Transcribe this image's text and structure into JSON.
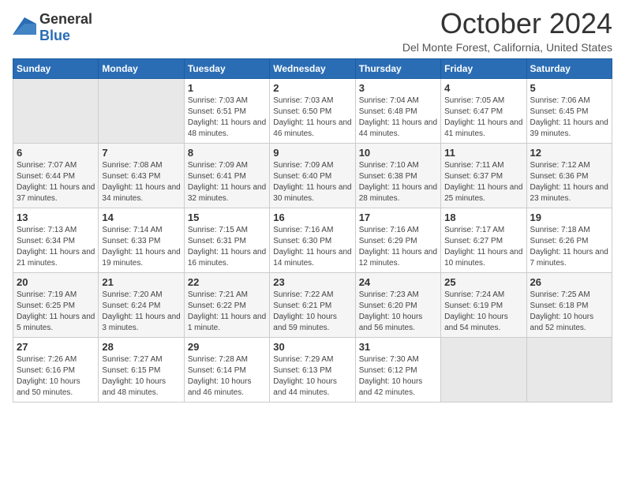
{
  "header": {
    "logo_general": "General",
    "logo_blue": "Blue",
    "month_title": "October 2024",
    "location": "Del Monte Forest, California, United States"
  },
  "calendar": {
    "days_of_week": [
      "Sunday",
      "Monday",
      "Tuesday",
      "Wednesday",
      "Thursday",
      "Friday",
      "Saturday"
    ],
    "weeks": [
      [
        {
          "day": "",
          "sunrise": "",
          "sunset": "",
          "daylight": ""
        },
        {
          "day": "",
          "sunrise": "",
          "sunset": "",
          "daylight": ""
        },
        {
          "day": "1",
          "sunrise": "Sunrise: 7:03 AM",
          "sunset": "Sunset: 6:51 PM",
          "daylight": "Daylight: 11 hours and 48 minutes."
        },
        {
          "day": "2",
          "sunrise": "Sunrise: 7:03 AM",
          "sunset": "Sunset: 6:50 PM",
          "daylight": "Daylight: 11 hours and 46 minutes."
        },
        {
          "day": "3",
          "sunrise": "Sunrise: 7:04 AM",
          "sunset": "Sunset: 6:48 PM",
          "daylight": "Daylight: 11 hours and 44 minutes."
        },
        {
          "day": "4",
          "sunrise": "Sunrise: 7:05 AM",
          "sunset": "Sunset: 6:47 PM",
          "daylight": "Daylight: 11 hours and 41 minutes."
        },
        {
          "day": "5",
          "sunrise": "Sunrise: 7:06 AM",
          "sunset": "Sunset: 6:45 PM",
          "daylight": "Daylight: 11 hours and 39 minutes."
        }
      ],
      [
        {
          "day": "6",
          "sunrise": "Sunrise: 7:07 AM",
          "sunset": "Sunset: 6:44 PM",
          "daylight": "Daylight: 11 hours and 37 minutes."
        },
        {
          "day": "7",
          "sunrise": "Sunrise: 7:08 AM",
          "sunset": "Sunset: 6:43 PM",
          "daylight": "Daylight: 11 hours and 34 minutes."
        },
        {
          "day": "8",
          "sunrise": "Sunrise: 7:09 AM",
          "sunset": "Sunset: 6:41 PM",
          "daylight": "Daylight: 11 hours and 32 minutes."
        },
        {
          "day": "9",
          "sunrise": "Sunrise: 7:09 AM",
          "sunset": "Sunset: 6:40 PM",
          "daylight": "Daylight: 11 hours and 30 minutes."
        },
        {
          "day": "10",
          "sunrise": "Sunrise: 7:10 AM",
          "sunset": "Sunset: 6:38 PM",
          "daylight": "Daylight: 11 hours and 28 minutes."
        },
        {
          "day": "11",
          "sunrise": "Sunrise: 7:11 AM",
          "sunset": "Sunset: 6:37 PM",
          "daylight": "Daylight: 11 hours and 25 minutes."
        },
        {
          "day": "12",
          "sunrise": "Sunrise: 7:12 AM",
          "sunset": "Sunset: 6:36 PM",
          "daylight": "Daylight: 11 hours and 23 minutes."
        }
      ],
      [
        {
          "day": "13",
          "sunrise": "Sunrise: 7:13 AM",
          "sunset": "Sunset: 6:34 PM",
          "daylight": "Daylight: 11 hours and 21 minutes."
        },
        {
          "day": "14",
          "sunrise": "Sunrise: 7:14 AM",
          "sunset": "Sunset: 6:33 PM",
          "daylight": "Daylight: 11 hours and 19 minutes."
        },
        {
          "day": "15",
          "sunrise": "Sunrise: 7:15 AM",
          "sunset": "Sunset: 6:31 PM",
          "daylight": "Daylight: 11 hours and 16 minutes."
        },
        {
          "day": "16",
          "sunrise": "Sunrise: 7:16 AM",
          "sunset": "Sunset: 6:30 PM",
          "daylight": "Daylight: 11 hours and 14 minutes."
        },
        {
          "day": "17",
          "sunrise": "Sunrise: 7:16 AM",
          "sunset": "Sunset: 6:29 PM",
          "daylight": "Daylight: 11 hours and 12 minutes."
        },
        {
          "day": "18",
          "sunrise": "Sunrise: 7:17 AM",
          "sunset": "Sunset: 6:27 PM",
          "daylight": "Daylight: 11 hours and 10 minutes."
        },
        {
          "day": "19",
          "sunrise": "Sunrise: 7:18 AM",
          "sunset": "Sunset: 6:26 PM",
          "daylight": "Daylight: 11 hours and 7 minutes."
        }
      ],
      [
        {
          "day": "20",
          "sunrise": "Sunrise: 7:19 AM",
          "sunset": "Sunset: 6:25 PM",
          "daylight": "Daylight: 11 hours and 5 minutes."
        },
        {
          "day": "21",
          "sunrise": "Sunrise: 7:20 AM",
          "sunset": "Sunset: 6:24 PM",
          "daylight": "Daylight: 11 hours and 3 minutes."
        },
        {
          "day": "22",
          "sunrise": "Sunrise: 7:21 AM",
          "sunset": "Sunset: 6:22 PM",
          "daylight": "Daylight: 11 hours and 1 minute."
        },
        {
          "day": "23",
          "sunrise": "Sunrise: 7:22 AM",
          "sunset": "Sunset: 6:21 PM",
          "daylight": "Daylight: 10 hours and 59 minutes."
        },
        {
          "day": "24",
          "sunrise": "Sunrise: 7:23 AM",
          "sunset": "Sunset: 6:20 PM",
          "daylight": "Daylight: 10 hours and 56 minutes."
        },
        {
          "day": "25",
          "sunrise": "Sunrise: 7:24 AM",
          "sunset": "Sunset: 6:19 PM",
          "daylight": "Daylight: 10 hours and 54 minutes."
        },
        {
          "day": "26",
          "sunrise": "Sunrise: 7:25 AM",
          "sunset": "Sunset: 6:18 PM",
          "daylight": "Daylight: 10 hours and 52 minutes."
        }
      ],
      [
        {
          "day": "27",
          "sunrise": "Sunrise: 7:26 AM",
          "sunset": "Sunset: 6:16 PM",
          "daylight": "Daylight: 10 hours and 50 minutes."
        },
        {
          "day": "28",
          "sunrise": "Sunrise: 7:27 AM",
          "sunset": "Sunset: 6:15 PM",
          "daylight": "Daylight: 10 hours and 48 minutes."
        },
        {
          "day": "29",
          "sunrise": "Sunrise: 7:28 AM",
          "sunset": "Sunset: 6:14 PM",
          "daylight": "Daylight: 10 hours and 46 minutes."
        },
        {
          "day": "30",
          "sunrise": "Sunrise: 7:29 AM",
          "sunset": "Sunset: 6:13 PM",
          "daylight": "Daylight: 10 hours and 44 minutes."
        },
        {
          "day": "31",
          "sunrise": "Sunrise: 7:30 AM",
          "sunset": "Sunset: 6:12 PM",
          "daylight": "Daylight: 10 hours and 42 minutes."
        },
        {
          "day": "",
          "sunrise": "",
          "sunset": "",
          "daylight": ""
        },
        {
          "day": "",
          "sunrise": "",
          "sunset": "",
          "daylight": ""
        }
      ]
    ]
  }
}
